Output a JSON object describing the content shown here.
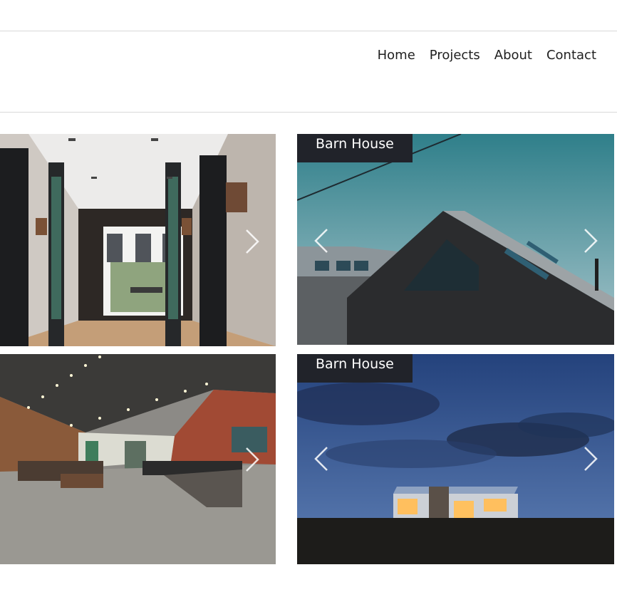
{
  "nav": {
    "items": [
      {
        "label": "Home"
      },
      {
        "label": "Projects"
      },
      {
        "label": "About"
      },
      {
        "label": "Contact"
      }
    ]
  },
  "gallery": {
    "tiles": [
      {
        "photo": "hallway-interior-photo",
        "caption": ""
      },
      {
        "photo": "barn-house-roof-photo",
        "caption": "Barn House"
      },
      {
        "photo": "loft-kitchen-interior-photo",
        "caption": ""
      },
      {
        "photo": "barn-house-dusk-photo",
        "caption": "Barn House"
      }
    ],
    "arrow_icons": {
      "prev": "chevron-left-icon",
      "next": "chevron-right-icon"
    }
  },
  "colors": {
    "caption_bg": "#21232a",
    "caption_text": "#ffffff",
    "nav_text": "#1f1f1f",
    "divider": "#d9d9d9"
  }
}
